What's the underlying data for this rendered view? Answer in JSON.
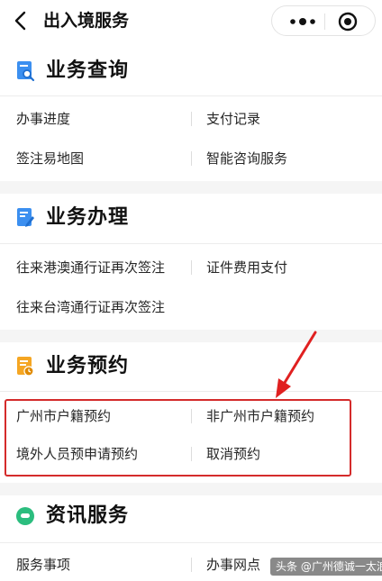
{
  "header": {
    "title": "出入境服务"
  },
  "sections": [
    {
      "title": "业务查询",
      "icon": "search-doc-icon",
      "items": [
        "办事进度",
        "支付记录",
        "签注易地图",
        "智能咨询服务"
      ]
    },
    {
      "title": "业务办理",
      "icon": "edit-doc-icon",
      "items": [
        "往来港澳通行证再次签注",
        "证件费用支付",
        "往来台湾通行证再次签注"
      ]
    },
    {
      "title": "业务预约",
      "icon": "appointment-doc-icon",
      "items": [
        "广州市户籍预约",
        "非广州市户籍预约",
        "境外人员预申请预约",
        "取消预约"
      ]
    },
    {
      "title": "资讯服务",
      "icon": "chat-bubble-icon",
      "items": [
        "服务事项",
        "办事网点"
      ]
    }
  ],
  "watermark": "头条 @广州德诚一太浪",
  "colors": {
    "accent_blue": "#3b8ff0",
    "accent_orange": "#f5a623",
    "accent_green": "#2bbd7e",
    "highlight_red": "#d42b2b"
  }
}
